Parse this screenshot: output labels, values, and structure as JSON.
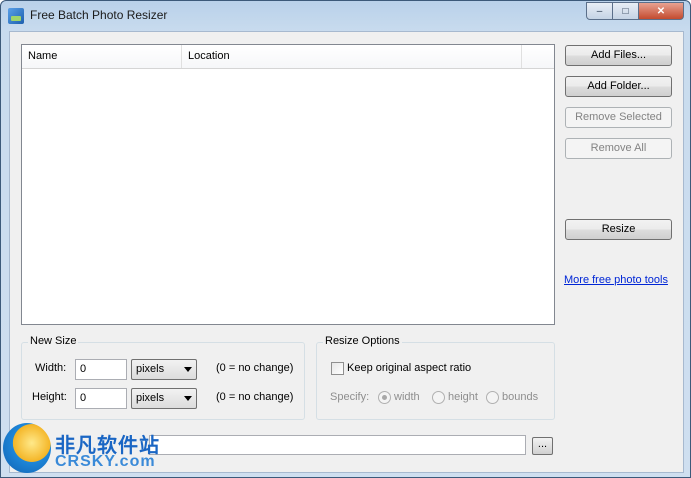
{
  "window": {
    "title": "Free Batch Photo Resizer"
  },
  "caption": {
    "minimize": "–",
    "maximize": "□",
    "close": "✕"
  },
  "filelist": {
    "columns": [
      "Name",
      "Location"
    ]
  },
  "actions": {
    "add_files": "Add Files...",
    "add_folder": "Add Folder...",
    "remove_selected": "Remove Selected",
    "remove_all": "Remove All",
    "resize": "Resize",
    "more_tools_link": "More free photo tools"
  },
  "new_size": {
    "group_label": "New Size",
    "width_label": "Width:",
    "width_value": "0",
    "width_unit": "pixels",
    "width_hint": "(0 = no change)",
    "height_label": "Height:",
    "height_value": "0",
    "height_unit": "pixels",
    "height_hint": "(0 = no change)"
  },
  "resize_options": {
    "group_label": "Resize Options",
    "keep_aspect_label": "Keep original aspect ratio",
    "keep_aspect_checked": false,
    "specify_label": "Specify:",
    "options": [
      "width",
      "height",
      "bounds"
    ],
    "selected": "width"
  },
  "output": {
    "browse_label": "...",
    "path_value": ""
  },
  "watermark": {
    "cn": "非凡软件站",
    "en": "CRSKY.com"
  }
}
